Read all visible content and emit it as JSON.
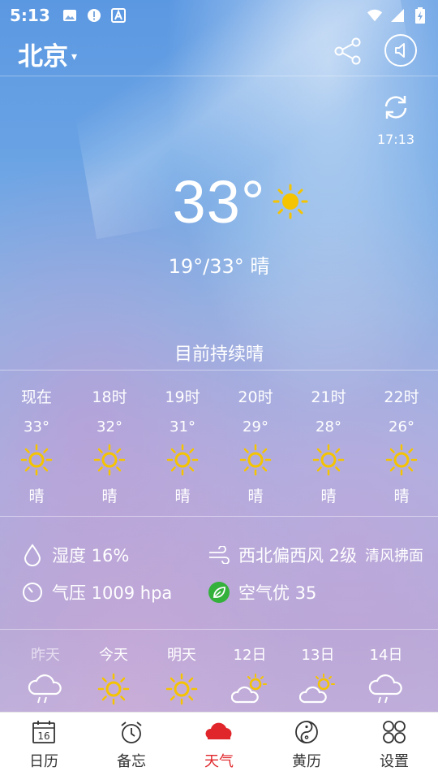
{
  "status_bar": {
    "time": "5:13"
  },
  "header": {
    "city": "北京",
    "city_arrow": "▾"
  },
  "refresh": {
    "time": "17:13"
  },
  "current": {
    "temp": "33°",
    "range": "19°/33°",
    "condition": "晴",
    "summary": "目前持续晴"
  },
  "hourly": [
    {
      "time": "现在",
      "temp": "33°",
      "cond": "晴"
    },
    {
      "time": "18时",
      "temp": "32°",
      "cond": "晴"
    },
    {
      "time": "19时",
      "temp": "31°",
      "cond": "晴"
    },
    {
      "time": "20时",
      "temp": "29°",
      "cond": "晴"
    },
    {
      "time": "21时",
      "temp": "28°",
      "cond": "晴"
    },
    {
      "time": "22时",
      "temp": "26°",
      "cond": "晴"
    }
  ],
  "details": {
    "humidity": "湿度 16%",
    "wind": "西北偏西风 2级",
    "wind_desc": "清风拂面",
    "pressure": "气压 1009 hpa",
    "air": "空气优 35"
  },
  "daily": [
    {
      "label": "昨天",
      "icon": "cloud-rain-icon"
    },
    {
      "label": "今天",
      "icon": "sun-icon"
    },
    {
      "label": "明天",
      "icon": "sun-icon"
    },
    {
      "label": "12日",
      "icon": "sun-cloud-icon"
    },
    {
      "label": "13日",
      "icon": "sun-cloud-icon"
    },
    {
      "label": "14日",
      "icon": "cloud-rain-icon"
    }
  ],
  "nav": {
    "calendar": "日历",
    "calendar_day": "16",
    "memo": "备忘",
    "weather": "天气",
    "almanac": "黄历",
    "settings": "设置"
  },
  "colors": {
    "active": "#e0262b",
    "sun": "#f5c400"
  }
}
